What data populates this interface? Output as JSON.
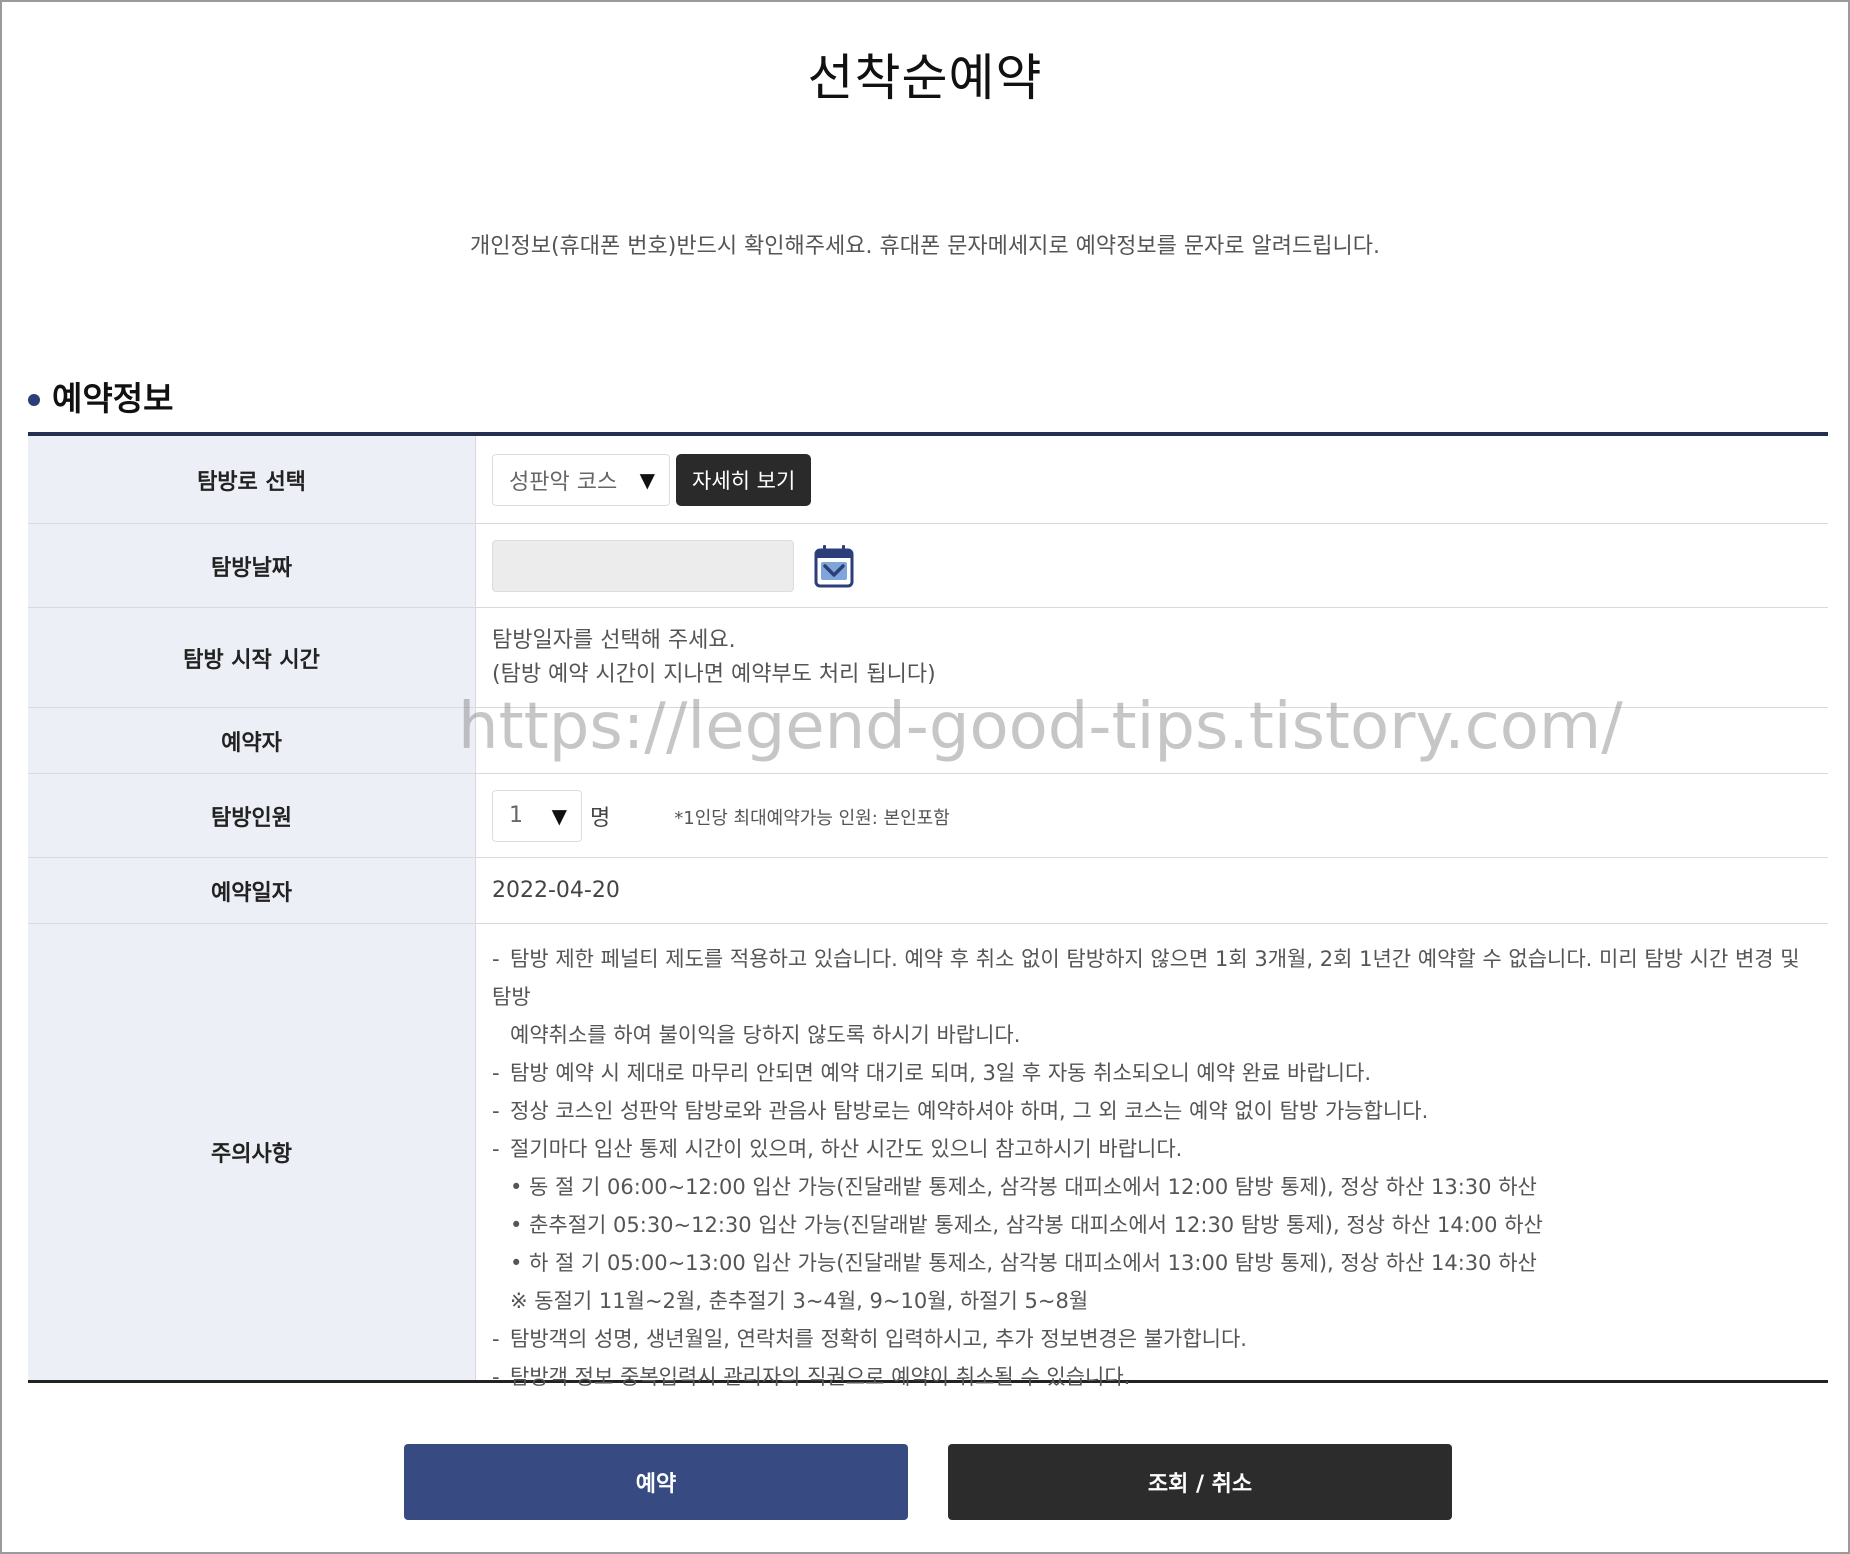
{
  "page": {
    "title": "선착순예약",
    "notice": "개인정보(휴대폰 번호)반드시 확인해주세요. 휴대폰 문자메세지로 예약정보를 문자로 알려드립니다."
  },
  "section": {
    "title": "예약정보"
  },
  "form": {
    "course": {
      "label": "탐방로 선택",
      "selected": "성판악 코스",
      "detail_button": "자세히 보기"
    },
    "date": {
      "label": "탐방날짜",
      "value": ""
    },
    "start_time": {
      "label": "탐방 시작 시간",
      "line1": "탐방일자를 선택해 주세요.",
      "line2": "(탐방 예약 시간이 지나면 예약부도 처리 됩니다)"
    },
    "reserver": {
      "label": "예약자"
    },
    "people": {
      "label": "탐방인원",
      "selected": "1",
      "unit": "명",
      "note": "*1인당 최대예약가능 인원: 본인포함"
    },
    "reservation_date": {
      "label": "예약일자",
      "value": "2022-04-20"
    },
    "cautions": {
      "label": "주의사항",
      "items": [
        "탐방 제한 페널티 제도를 적용하고 있습니다. 예약 후 취소 없이 탐방하지 않으면 1회 3개월, 2회 1년간 예약할 수 없습니다. 미리 탐방 시간 변경 및 탐방",
        "예약취소를 하여 불이익을 당하지 않도록 하시기 바랍니다.",
        "탐방 예약 시 제대로 마무리 안되면 예약 대기로 되며, 3일 후 자동 취소되오니 예약 완료 바랍니다.",
        "정상 코스인 성판악 탐방로와 관음사 탐방로는 예약하셔야 하며, 그 외 코스는 예약 없이 탐방 가능합니다.",
        "절기마다 입산 통제 시간이 있으며, 하산 시간도 있으니 참고하시기 바랍니다.",
        "• 동 절 기 06:00~12:00 입산 가능(진달래밭 통제소, 삼각봉 대피소에서 12:00 탐방 통제), 정상 하산 13:30 하산",
        "• 춘추절기 05:30~12:30 입산 가능(진달래밭 통제소, 삼각봉 대피소에서 12:30 탐방 통제), 정상 하산 14:00 하산",
        "• 하 절 기 05:00~13:00 입산 가능(진달래밭 통제소, 삼각봉 대피소에서 13:00 탐방 통제), 정상 하산 14:30 하산",
        "※ 동절기 11월~2월, 춘추절기 3~4월, 9~10월, 하절기 5~8월",
        "탐방객의 성명, 생년월일, 연락처를 정확히 입력하시고, 추가 정보변경은 불가합니다.",
        "탐방객 정보 중복입력시 관리자의 직권으로 예약이 취소될 수 있습니다."
      ]
    }
  },
  "watermark": "https://legend-good-tips.tistory.com/",
  "buttons": {
    "reserve": "예약",
    "inquiry_cancel": "조회 / 취소"
  },
  "icons": {
    "dropdown": "▼",
    "calendar": "calendar-icon"
  },
  "colors": {
    "primary_button": "#374b82",
    "dark_button": "#2c2c2c",
    "header_cell": "#eceff5",
    "table_top_border": "#24304f"
  }
}
